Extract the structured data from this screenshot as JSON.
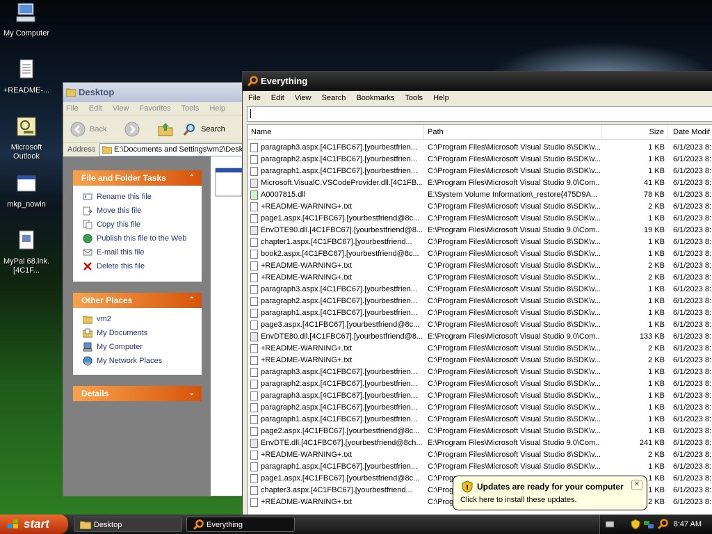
{
  "desktop_icons": [
    {
      "label": "My Computer"
    },
    {
      "label": "+README-..."
    },
    {
      "label": "Microsoft Outlook"
    },
    {
      "label": "mkp_nowin"
    },
    {
      "label": "MyPal 68.lnk.[4C1F..."
    }
  ],
  "explorer": {
    "title": "Desktop",
    "menu": [
      "File",
      "Edit",
      "View",
      "Favorites",
      "Tools",
      "Help"
    ],
    "toolbar": {
      "back": "Back",
      "search": "Search"
    },
    "address_label": "Address",
    "address_value": "E:\\Documents and Settings\\vm2\\Desktop",
    "file_tasks": {
      "title": "File and Folder Tasks",
      "items": [
        "Rename this file",
        "Move this file",
        "Copy this file",
        "Publish this file to the Web",
        "E-mail this file",
        "Delete this file"
      ]
    },
    "other_places": {
      "title": "Other Places",
      "items": [
        "vm2",
        "My Documents",
        "My Computer",
        "My Network Places"
      ]
    },
    "details": {
      "title": "Details"
    }
  },
  "everything": {
    "title": "Everything",
    "menu": [
      "File",
      "Edit",
      "View",
      "Search",
      "Bookmarks",
      "Tools",
      "Help"
    ],
    "search_value": "",
    "columns": {
      "name": "Name",
      "path": "Path",
      "size": "Size",
      "date": "Date Modif"
    },
    "rows": [
      {
        "name": "paragraph3.aspx.[4C1FBC67].[yourbestfrien...",
        "path": "C:\\Program Files\\Microsoft Visual Studio 8\\SDK\\v...",
        "size": "1 KB",
        "date": "6/1/2023 8:",
        "icon": "file"
      },
      {
        "name": "paragraph2.aspx.[4C1FBC67].[yourbestfrien...",
        "path": "C:\\Program Files\\Microsoft Visual Studio 8\\SDK\\v...",
        "size": "1 KB",
        "date": "6/1/2023 8:",
        "icon": "file"
      },
      {
        "name": "paragraph1.aspx.[4C1FBC67].[yourbestfrien...",
        "path": "C:\\Program Files\\Microsoft Visual Studio 8\\SDK\\v...",
        "size": "1 KB",
        "date": "6/1/2023 8:",
        "icon": "file"
      },
      {
        "name": "Microsoft.VisualC.VSCodeProvider.dll.[4C1FB...",
        "path": "E:\\Program Files\\Microsoft Visual Studio 9.0\\Com...",
        "size": "41 KB",
        "date": "6/1/2023 8:",
        "icon": "dll"
      },
      {
        "name": "A0007815.dll",
        "path": "E:\\System Volume Information\\_restore{475D9A...",
        "size": "78 KB",
        "date": "6/1/2023 8:",
        "icon": "img"
      },
      {
        "name": "+README-WARNING+.txt",
        "path": "C:\\Program Files\\Microsoft Visual Studio 8\\SDK\\v...",
        "size": "2 KB",
        "date": "6/1/2023 8:",
        "icon": "file"
      },
      {
        "name": "page1.aspx.[4C1FBC67].[yourbestfriend@8c...",
        "path": "C:\\Program Files\\Microsoft Visual Studio 8\\SDK\\v...",
        "size": "1 KB",
        "date": "6/1/2023 8:",
        "icon": "file"
      },
      {
        "name": "EnvDTE90.dll.[4C1FBC67].[yourbestfriend@8...",
        "path": "E:\\Program Files\\Microsoft Visual Studio 9.0\\Com...",
        "size": "19 KB",
        "date": "6/1/2023 8:",
        "icon": "dll"
      },
      {
        "name": "chapter1.aspx.[4C1FBC67].[yourbestfriend...",
        "path": "C:\\Program Files\\Microsoft Visual Studio 8\\SDK\\v...",
        "size": "1 KB",
        "date": "6/1/2023 8:",
        "icon": "file"
      },
      {
        "name": "book2.aspx.[4C1FBC67].[yourbestfriend@8c...",
        "path": "C:\\Program Files\\Microsoft Visual Studio 8\\SDK\\v...",
        "size": "1 KB",
        "date": "6/1/2023 8:",
        "icon": "file"
      },
      {
        "name": "+README-WARNING+.txt",
        "path": "C:\\Program Files\\Microsoft Visual Studio 8\\SDK\\v...",
        "size": "2 KB",
        "date": "6/1/2023 8:",
        "icon": "file"
      },
      {
        "name": "+README-WARNING+.txt",
        "path": "C:\\Program Files\\Microsoft Visual Studio 8\\SDK\\v...",
        "size": "2 KB",
        "date": "6/1/2023 8:",
        "icon": "file"
      },
      {
        "name": "paragraph3.aspx.[4C1FBC67].[yourbestfrien...",
        "path": "C:\\Program Files\\Microsoft Visual Studio 8\\SDK\\v...",
        "size": "1 KB",
        "date": "6/1/2023 8:",
        "icon": "file"
      },
      {
        "name": "paragraph2.aspx.[4C1FBC67].[yourbestfrien...",
        "path": "C:\\Program Files\\Microsoft Visual Studio 8\\SDK\\v...",
        "size": "1 KB",
        "date": "6/1/2023 8:",
        "icon": "file"
      },
      {
        "name": "paragraph1.aspx.[4C1FBC67].[yourbestfrien...",
        "path": "C:\\Program Files\\Microsoft Visual Studio 8\\SDK\\v...",
        "size": "1 KB",
        "date": "6/1/2023 8:",
        "icon": "file"
      },
      {
        "name": "page3.aspx.[4C1FBC67].[yourbestfriend@8c...",
        "path": "C:\\Program Files\\Microsoft Visual Studio 8\\SDK\\v...",
        "size": "1 KB",
        "date": "6/1/2023 8:",
        "icon": "file"
      },
      {
        "name": "EnvDTE80.dll.[4C1FBC67].[yourbestfriend@8...",
        "path": "E:\\Program Files\\Microsoft Visual Studio 9.0\\Com...",
        "size": "133 KB",
        "date": "6/1/2023 8:",
        "icon": "dll"
      },
      {
        "name": "+README-WARNING+.txt",
        "path": "C:\\Program Files\\Microsoft Visual Studio 8\\SDK\\v...",
        "size": "2 KB",
        "date": "6/1/2023 8:",
        "icon": "file"
      },
      {
        "name": "+README-WARNING+.txt",
        "path": "C:\\Program Files\\Microsoft Visual Studio 8\\SDK\\v...",
        "size": "2 KB",
        "date": "6/1/2023 8:",
        "icon": "file"
      },
      {
        "name": "paragraph3.aspx.[4C1FBC67].[yourbestfrien...",
        "path": "C:\\Program Files\\Microsoft Visual Studio 8\\SDK\\v...",
        "size": "1 KB",
        "date": "6/1/2023 8:",
        "icon": "file"
      },
      {
        "name": "paragraph2.aspx.[4C1FBC67].[yourbestfrien...",
        "path": "C:\\Program Files\\Microsoft Visual Studio 8\\SDK\\v...",
        "size": "1 KB",
        "date": "6/1/2023 8:",
        "icon": "file"
      },
      {
        "name": "paragraph3.aspx.[4C1FBC67].[yourbestfrien...",
        "path": "C:\\Program Files\\Microsoft Visual Studio 8\\SDK\\v...",
        "size": "1 KB",
        "date": "6/1/2023 8:",
        "icon": "file"
      },
      {
        "name": "paragraph2.aspx.[4C1FBC67].[yourbestfrien...",
        "path": "C:\\Program Files\\Microsoft Visual Studio 8\\SDK\\v...",
        "size": "1 KB",
        "date": "6/1/2023 8:",
        "icon": "file"
      },
      {
        "name": "paragraph1.aspx.[4C1FBC67].[yourbestfrien...",
        "path": "C:\\Program Files\\Microsoft Visual Studio 8\\SDK\\v...",
        "size": "1 KB",
        "date": "6/1/2023 8:",
        "icon": "file"
      },
      {
        "name": "page2.aspx.[4C1FBC67].[yourbestfriend@8c...",
        "path": "C:\\Program Files\\Microsoft Visual Studio 8\\SDK\\v...",
        "size": "1 KB",
        "date": "6/1/2023 8:",
        "icon": "file"
      },
      {
        "name": "EnvDTE.dll.[4C1FBC67].[yourbestfriend@8ch...",
        "path": "E:\\Program Files\\Microsoft Visual Studio 9.0\\Com...",
        "size": "241 KB",
        "date": "6/1/2023 8:",
        "icon": "dll"
      },
      {
        "name": "+README-WARNING+.txt",
        "path": "C:\\Program Files\\Microsoft Visual Studio 8\\SDK\\v...",
        "size": "2 KB",
        "date": "6/1/2023 8:",
        "icon": "file"
      },
      {
        "name": "paragraph1.aspx.[4C1FBC67].[yourbestfrien...",
        "path": "C:\\Program Files\\Microsoft Visual Studio 8\\SDK\\v...",
        "size": "1 KB",
        "date": "6/1/2023 8:",
        "icon": "file"
      },
      {
        "name": "page1.aspx.[4C1FBC67].[yourbestfriend@8c...",
        "path": "C:\\Progr",
        "size": "1 KB",
        "date": "6/1/2023 8:",
        "icon": "file"
      },
      {
        "name": "chapter3.aspx.[4C1FBC67].[yourbestfriend...",
        "path": "C:\\Progr",
        "size": "1 KB",
        "date": "6/1/2023 8:",
        "icon": "file"
      },
      {
        "name": "+README-WARNING+.txt",
        "path": "C:\\Progr",
        "size": "2 KB",
        "date": "6/1/2023 8:",
        "icon": "file"
      }
    ]
  },
  "balloon": {
    "title": "Updates are ready for your computer",
    "body": "Click here to install these updates.",
    "close": "✕"
  },
  "taskbar": {
    "start_label": "start",
    "tasks": [
      {
        "label": "Desktop"
      },
      {
        "label": "Everything"
      }
    ],
    "clock": "8:47 AM"
  },
  "colors": {
    "task_pane_header": "#d6530a",
    "active_title": "#0e0e0e",
    "balloon_bg": "#ffffe1"
  }
}
